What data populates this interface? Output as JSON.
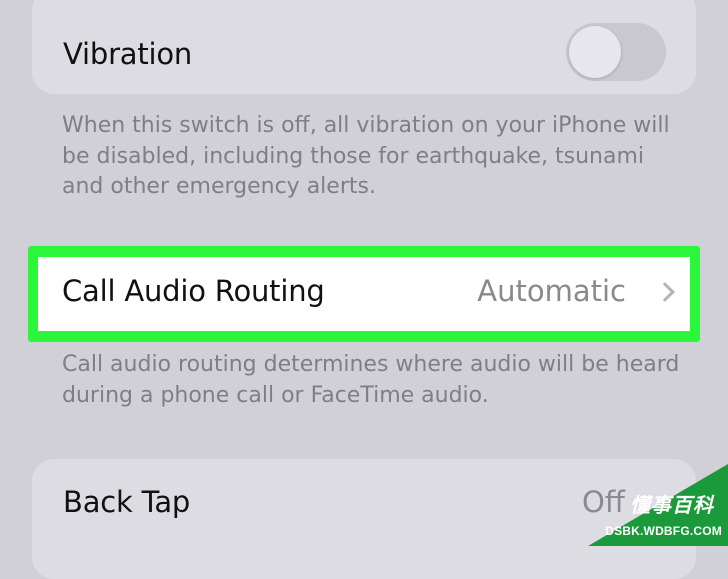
{
  "vibration": {
    "label": "Vibration",
    "toggle_on": false,
    "footnote": "When this switch is off, all vibration on your iPhone will be disabled, including those for earthquake, tsunami and other emergency alerts."
  },
  "call_audio_routing": {
    "label": "Call Audio Routing",
    "value": "Automatic",
    "footnote": "Call audio routing determines where audio will be heard during a phone call or FaceTime audio."
  },
  "back_tap": {
    "label": "Back Tap",
    "value": "Off"
  },
  "watermark": {
    "text_cn": "懂事百科",
    "text_en": "DSBK.WDBFG.COM"
  },
  "colors": {
    "highlight": "#2bf73a",
    "background": "#d1d0d6"
  },
  "icons": [
    "chevron-right-icon"
  ]
}
